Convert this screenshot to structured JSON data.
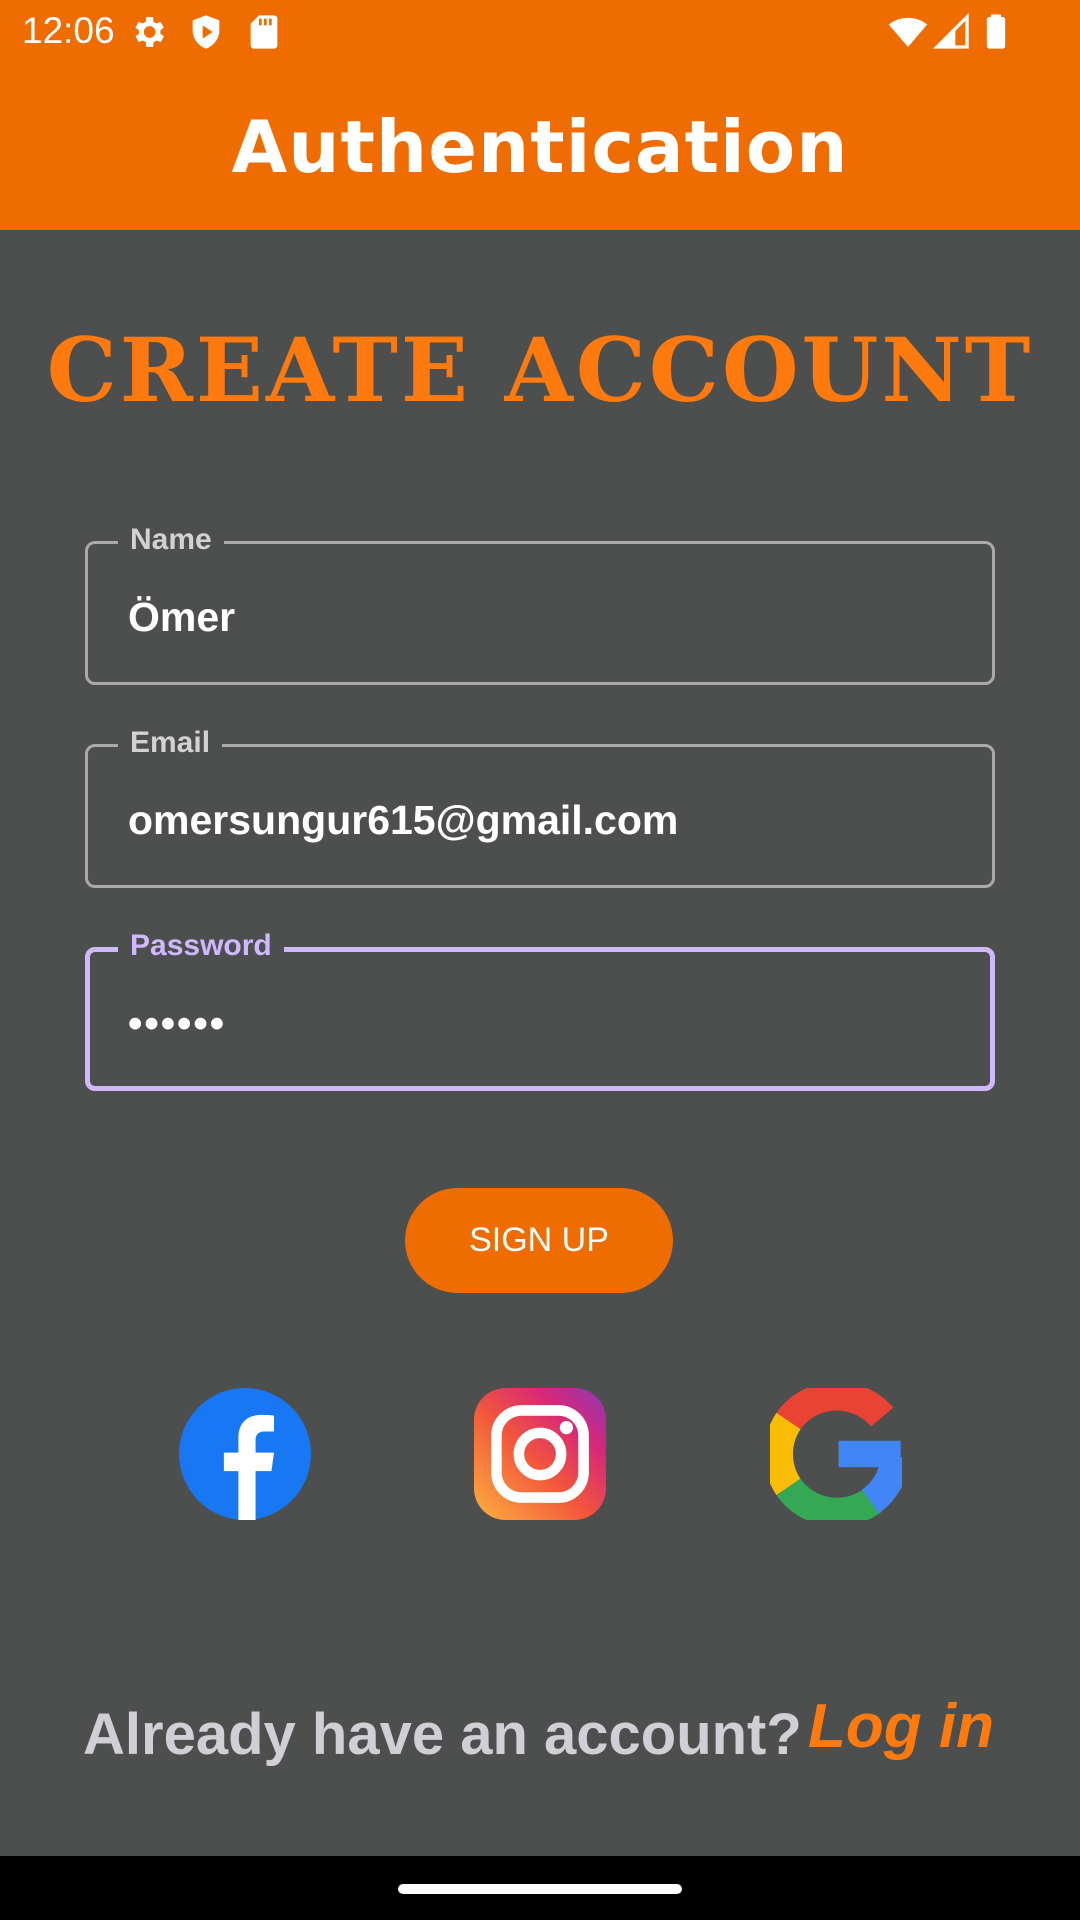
{
  "status_bar": {
    "time": "12:06",
    "left_icons": [
      "settings-icon",
      "shield-play-icon",
      "sd-card-icon"
    ],
    "right_icons": [
      "wifi-icon",
      "cell-signal-icon",
      "battery-icon"
    ]
  },
  "app_bar": {
    "title": "Authentication",
    "color": "#ef6c00"
  },
  "heading": "CREATE ACCOUNT",
  "form": {
    "name": {
      "label": "Name",
      "value": "Ömer"
    },
    "email": {
      "label": "Email",
      "value": "omersungur615@gmail.com"
    },
    "password": {
      "label": "Password",
      "value": "••••••",
      "focused": true
    }
  },
  "signup_button": "SIGN UP",
  "social": [
    "facebook-icon",
    "instagram-icon",
    "google-icon"
  ],
  "footer": {
    "question": "Already have an account?",
    "login_link": "Log in"
  },
  "colors": {
    "accent": "#ef6c00",
    "background": "#4d4f4e",
    "focus": "#d0b8ff",
    "heading": "#ff7a0e"
  }
}
